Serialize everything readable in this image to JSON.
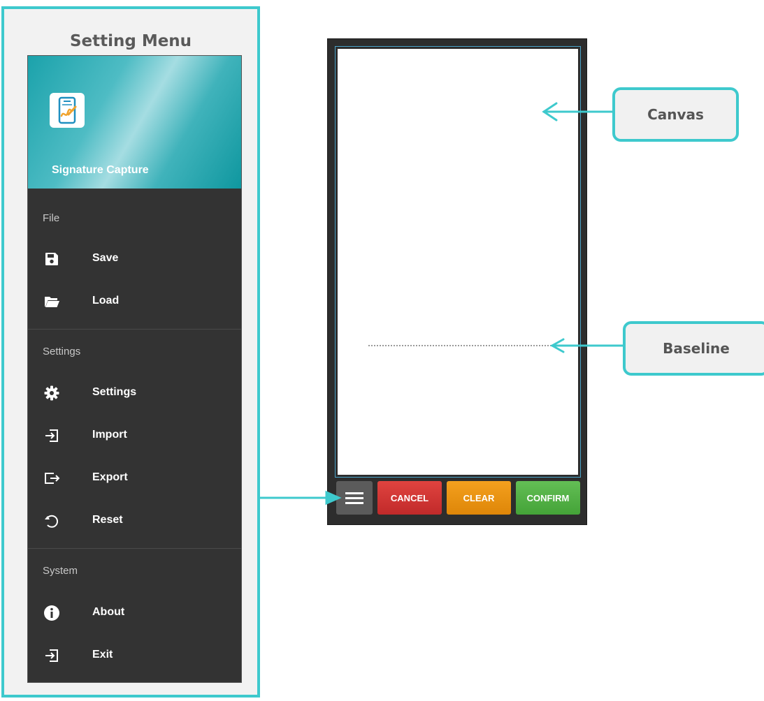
{
  "menu_panel": {
    "title": "Setting Menu",
    "app_name": "Signature Capture",
    "sections": [
      {
        "label": "File",
        "items": [
          {
            "label": "Save",
            "icon": "save-icon"
          },
          {
            "label": "Load",
            "icon": "folder-open-icon"
          }
        ]
      },
      {
        "label": "Settings",
        "items": [
          {
            "label": "Settings",
            "icon": "gear-icon"
          },
          {
            "label": "Import",
            "icon": "import-icon"
          },
          {
            "label": "Export",
            "icon": "export-icon"
          },
          {
            "label": "Reset",
            "icon": "reset-icon"
          }
        ]
      },
      {
        "label": "System",
        "items": [
          {
            "label": "About",
            "icon": "info-icon"
          },
          {
            "label": "Exit",
            "icon": "exit-icon"
          }
        ]
      }
    ]
  },
  "device": {
    "buttons": {
      "menu_icon": "hamburger-icon",
      "cancel": "CANCEL",
      "clear": "CLEAR",
      "confirm": "CONFIRM"
    }
  },
  "callouts": {
    "canvas": "Canvas",
    "baseline": "Baseline"
  },
  "colors": {
    "accent": "#3ec9cd",
    "drawer_bg": "#333333",
    "cancel": "#d13535",
    "clear": "#eb930f",
    "confirm": "#52b046"
  }
}
